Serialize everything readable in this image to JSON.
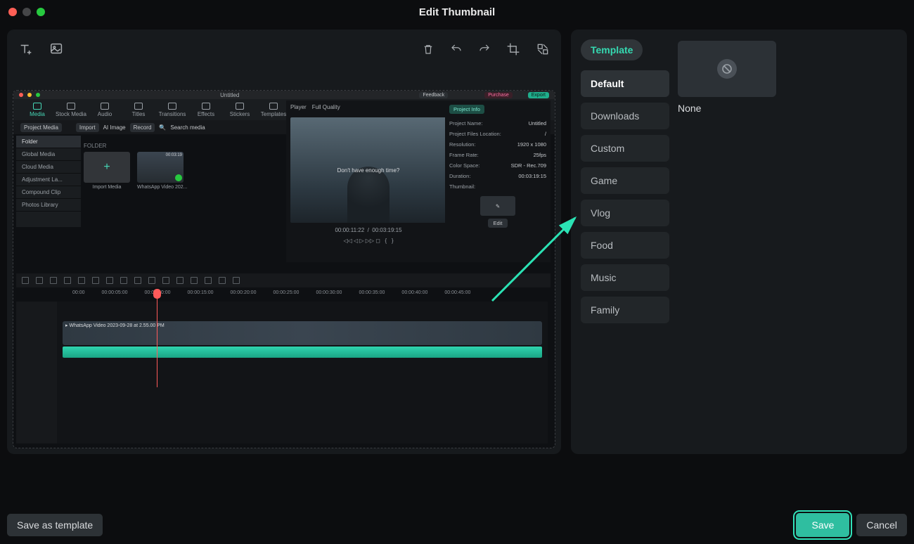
{
  "title": "Edit Thumbnail",
  "toolbar": {
    "save_as_template": "Save as template",
    "save": "Save",
    "cancel": "Cancel"
  },
  "right": {
    "template_pill": "Template",
    "categories": [
      "Default",
      "Downloads",
      "Custom",
      "Game",
      "Vlog",
      "Food",
      "Music",
      "Family"
    ],
    "none": "None"
  },
  "editor": {
    "doc_title": "Untitled",
    "feedback": "Feedback",
    "purchase": "Purchase",
    "export": "Export",
    "tabs": [
      "Media",
      "Stock Media",
      "Audio",
      "Titles",
      "Transitions",
      "Effects",
      "Stickers",
      "Templates"
    ],
    "row2": {
      "project_media": "Project Media",
      "import": "Import",
      "ai_image": "AI Image",
      "record": "Record",
      "search": "Search media"
    },
    "sidebar": {
      "folder": "Folder",
      "items": [
        "Global Media",
        "Cloud Media",
        "Adjustment La...",
        "Compound Clip",
        "Photos Library"
      ]
    },
    "media": {
      "folder_lbl": "FOLDER",
      "import_media": "Import Media",
      "clip_time": "00:03:19",
      "clip_name": "WhatsApp Video 202..."
    },
    "player": {
      "label": "Player",
      "quality": "Full Quality",
      "caption": "Don't have enough time?",
      "time_current": "00:00:11:22",
      "time_total": "00:03:19:15"
    },
    "info": {
      "head": "Project Info",
      "rows": [
        [
          "Project Name:",
          "Untitled"
        ],
        [
          "Project Files Location:",
          "/"
        ],
        [
          "Resolution:",
          "1920 x 1080"
        ],
        [
          "Frame Rate:",
          "25fps"
        ],
        [
          "Color Space:",
          "SDR - Rec.709"
        ],
        [
          "Duration:",
          "00:03:19:15"
        ],
        [
          "Thumbnail:",
          ""
        ]
      ],
      "edit": "Edit"
    },
    "ruler": [
      "00:00",
      "00:00:05:00",
      "00:00:10:00",
      "00:00:15:00",
      "00:00:20:00",
      "00:00:25:00",
      "00:00:30:00",
      "00:00:35:00",
      "00:00:40:00",
      "00:00:45:00"
    ],
    "clip_label": "WhatsApp Video 2023-09-28 at 2.55.00 PM"
  }
}
